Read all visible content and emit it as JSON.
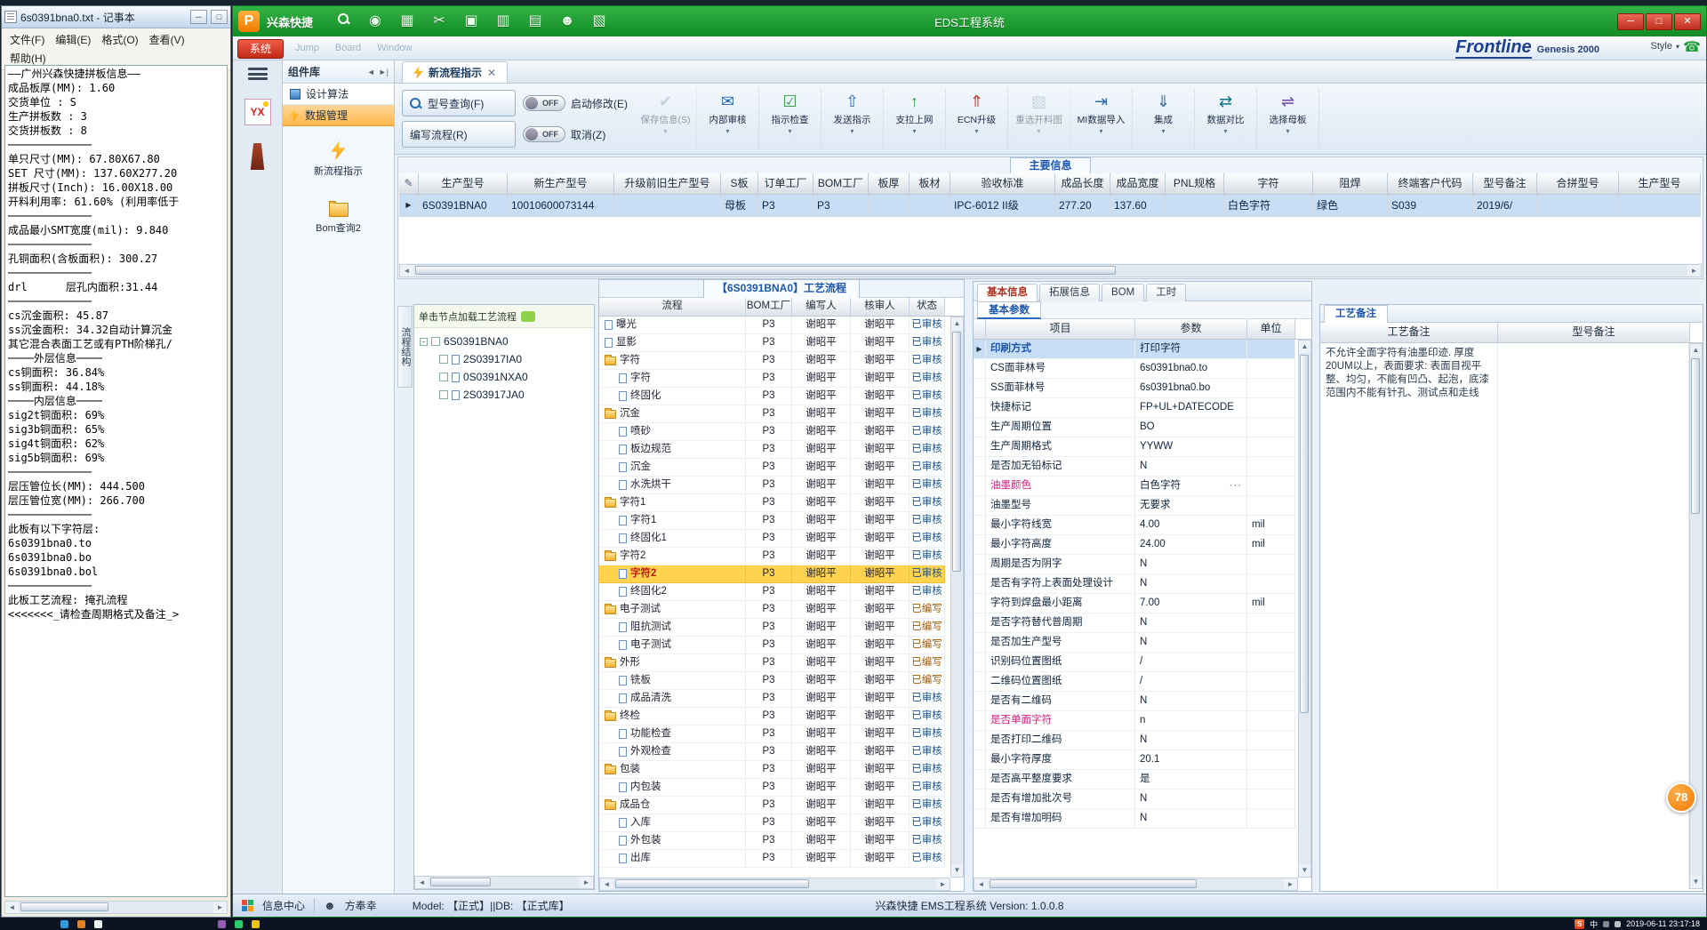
{
  "badge": {
    "value": "78"
  },
  "taskbar": {
    "datetime": "2019-06-11 23:17:18",
    "ime": "中"
  },
  "notepad": {
    "title": "6s0391bna0.txt - 记事本",
    "menu": [
      "文件(F)",
      "编辑(E)",
      "格式(O)",
      "查看(V)",
      "帮助(H)"
    ],
    "lines": [
      "——广州兴森快捷拼板信息——",
      "成品板厚(MM): 1.60",
      "交货单位 : S",
      "生产拼板数 : 3",
      "交货拼板数 : 8",
      "─────────────",
      "",
      "单只尺寸(MM): 67.80X67.80",
      "SET 尺寸(MM): 137.60X277.20",
      "拼板尺寸(Inch): 16.00X18.00",
      "开料利用率: 61.60% (利用率低于",
      "─────────────",
      "",
      "成品最小SMT宽度(mil): 9.840",
      "─────────────",
      "",
      "孔铜面积(含板面积): 300.27",
      "─────────────",
      "",
      "drl      层孔内面积:31.44",
      "─────────────",
      "",
      "cs沉金面积: 45.87",
      "ss沉金面积: 34.32自动计算沉金",
      "其它混合表面工艺或有PTH阶梯孔/",
      "────外层信息────",
      "cs铜面积: 36.84%",
      "ss铜面积: 44.18%",
      "────内层信息────",
      "sig2t铜面积: 69%",
      "sig3b铜面积: 65%",
      "sig4t铜面积: 62%",
      "sig5b铜面积: 69%",
      "─────────────",
      "",
      "层压管位长(MM): 444.500",
      "层压管位宽(MM): 266.700",
      "─────────────",
      "",
      "此板有以下字符层:",
      "6s0391bna0.to",
      "6s0391bna0.bo",
      "6s0391bna0.bol",
      "─────────────",
      "",
      "此板工艺流程: 掩孔流程",
      "<<<<<<<_请检查周期格式及备注_>"
    ]
  },
  "app": {
    "titlebar": {
      "brand": "兴森快捷",
      "title": "EDS工程系统",
      "icons": [
        {
          "name": "search-icon",
          "glyph": ""
        },
        {
          "name": "globe-icon",
          "glyph": "◉"
        },
        {
          "name": "table-icon",
          "glyph": "▦"
        },
        {
          "name": "scissors-icon",
          "glyph": "✂"
        },
        {
          "name": "panel-icon",
          "glyph": "▣"
        },
        {
          "name": "columns-icon",
          "glyph": "▥"
        },
        {
          "name": "rows-icon",
          "glyph": "▤"
        },
        {
          "name": "user-icon",
          "glyph": "☻"
        },
        {
          "name": "layers-icon",
          "glyph": "▧"
        }
      ]
    },
    "menubar": {
      "items": [
        "Jump",
        "Board",
        "Window"
      ],
      "logo": "Frontline",
      "logo2": "Genesis 2000",
      "style_label": "Style"
    },
    "nav": {
      "system_tab": "系统",
      "panel_title": "组件库",
      "tab_design": "设计算法",
      "tab_data": "数据管理",
      "item_flow": "新流程指示",
      "item_bom": "Bom查询2"
    },
    "doc_tab": {
      "label": "新流程指示"
    },
    "ribbon": {
      "query": "型号查询(F)",
      "write": "编写流程(R)",
      "edit": "启动修改(E)",
      "cancel": "取消(Z)",
      "toggle_label": "OFF",
      "buttons": [
        {
          "name": "save-info-button",
          "label": "保存信息(S)",
          "icon": "save-icon",
          "glyph": "✔",
          "color": "#9aa8b5",
          "disabled": true
        },
        {
          "name": "internal-review-button",
          "label": "内部审核",
          "icon": "mail-icon",
          "glyph": "✉",
          "color": "#2b6cb0",
          "disabled": false
        },
        {
          "name": "instruction-check-button",
          "label": "指示检查",
          "icon": "check-icon",
          "glyph": "☑",
          "color": "#2f9e44",
          "disabled": false
        },
        {
          "name": "send-instruction-button",
          "label": "发送指示",
          "icon": "send-icon",
          "glyph": "⇧",
          "color": "#2b6cb0",
          "disabled": false
        },
        {
          "name": "upload-online-button",
          "label": "支拉上网",
          "icon": "upload-icon",
          "glyph": "↑",
          "color": "#2f9e44",
          "disabled": false
        },
        {
          "name": "ecn-upgrade-button",
          "label": "ECN升级",
          "icon": "ecn-icon",
          "glyph": "⇑",
          "color": "#c0392b",
          "disabled": false
        },
        {
          "name": "reselect-panel-button",
          "label": "重选开料图",
          "icon": "image-icon",
          "glyph": "▧",
          "color": "#98a8b8",
          "disabled": true
        },
        {
          "name": "mi-import-button",
          "label": "MI数据导入",
          "icon": "import-icon",
          "glyph": "⇥",
          "color": "#2b6cb0",
          "disabled": false
        },
        {
          "name": "integrate-button",
          "label": "集成",
          "icon": "integrate-icon",
          "glyph": "⇓",
          "color": "#2b6cb0",
          "disabled": false
        },
        {
          "name": "data-compare-button",
          "label": "数据对比",
          "icon": "compare-icon",
          "glyph": "⇄",
          "color": "#0b7285",
          "disabled": false
        },
        {
          "name": "select-motherboard-button",
          "label": "选择母板",
          "icon": "select-icon",
          "glyph": "⇌",
          "color": "#7048a8",
          "disabled": false
        }
      ]
    },
    "main_info": {
      "caption": "主要信息",
      "columns": [
        "生产型号",
        "新生产型号",
        "升级前旧生产型号",
        "S板",
        "订单工厂",
        "BOM工厂",
        "板厚",
        "板材",
        "验收标准",
        "成品长度",
        "成品宽度",
        "PNL规格",
        "字符",
        "阻焊",
        "终端客户代码",
        "型号备注",
        "合拼型号",
        "生产型号"
      ],
      "row": [
        "6S0391BNA0",
        "10010600073144",
        "",
        "母板",
        "P3",
        "P3",
        "",
        "",
        "IPC-6012 II级",
        "277.20",
        "137.60",
        "",
        "白色字符",
        "绿色",
        "S039",
        "2019/6/",
        "",
        ""
      ]
    },
    "tree": {
      "tab": "流程结构",
      "header": "单击节点加载工艺流程",
      "root": "6S0391BNA0",
      "children": [
        "2S03917IA0",
        "0S0391NXA0",
        "2S03917JA0"
      ]
    },
    "flow": {
      "title": "【6S0391BNA0】工艺流程",
      "columns": [
        "流程",
        "BOM工厂",
        "编写人",
        "核审人",
        "状态"
      ],
      "rows": [
        {
          "name": "曝光",
          "level": 1,
          "kind": "leaf",
          "bom": "P3",
          "writer": "谢昭平",
          "reviewer": "谢昭平",
          "status": "已审核",
          "highlight": false
        },
        {
          "name": "显影",
          "level": 1,
          "kind": "leaf",
          "bom": "P3",
          "writer": "谢昭平",
          "reviewer": "谢昭平",
          "status": "已审核",
          "highlight": false
        },
        {
          "name": "字符",
          "level": 1,
          "kind": "folder",
          "bom": "P3",
          "writer": "谢昭平",
          "reviewer": "谢昭平",
          "status": "已审核",
          "highlight": false
        },
        {
          "name": "字符",
          "level": 2,
          "kind": "leaf",
          "bom": "P3",
          "writer": "谢昭平",
          "reviewer": "谢昭平",
          "status": "已审核",
          "highlight": false
        },
        {
          "name": "终固化",
          "level": 2,
          "kind": "leaf",
          "bom": "P3",
          "writer": "谢昭平",
          "reviewer": "谢昭平",
          "status": "已审核",
          "highlight": false
        },
        {
          "name": "沉金",
          "level": 1,
          "kind": "folder",
          "bom": "P3",
          "writer": "谢昭平",
          "reviewer": "谢昭平",
          "status": "已审核",
          "highlight": false
        },
        {
          "name": "喷砂",
          "level": 2,
          "kind": "leaf",
          "bom": "P3",
          "writer": "谢昭平",
          "reviewer": "谢昭平",
          "status": "已审核",
          "highlight": false
        },
        {
          "name": "板边规范",
          "level": 2,
          "kind": "leaf",
          "bom": "P3",
          "writer": "谢昭平",
          "reviewer": "谢昭平",
          "status": "已审核",
          "highlight": false
        },
        {
          "name": "沉金",
          "level": 2,
          "kind": "leaf",
          "bom": "P3",
          "writer": "谢昭平",
          "reviewer": "谢昭平",
          "status": "已审核",
          "highlight": false
        },
        {
          "name": "水洗烘干",
          "level": 2,
          "kind": "leaf",
          "bom": "P3",
          "writer": "谢昭平",
          "reviewer": "谢昭平",
          "status": "已审核",
          "highlight": false
        },
        {
          "name": "字符1",
          "level": 1,
          "kind": "folder",
          "bom": "P3",
          "writer": "谢昭平",
          "reviewer": "谢昭平",
          "status": "已审核",
          "highlight": false
        },
        {
          "name": "字符1",
          "level": 2,
          "kind": "leaf",
          "bom": "P3",
          "writer": "谢昭平",
          "reviewer": "谢昭平",
          "status": "已审核",
          "highlight": false
        },
        {
          "name": "终固化1",
          "level": 2,
          "kind": "leaf",
          "bom": "P3",
          "writer": "谢昭平",
          "reviewer": "谢昭平",
          "status": "已审核",
          "highlight": false
        },
        {
          "name": "字符2",
          "level": 1,
          "kind": "folder",
          "bom": "P3",
          "writer": "谢昭平",
          "reviewer": "谢昭平",
          "status": "已审核",
          "highlight": false
        },
        {
          "name": "字符2",
          "level": 2,
          "kind": "leaf",
          "bom": "P3",
          "writer": "谢昭平",
          "reviewer": "谢昭平",
          "status": "已审核",
          "highlight": true
        },
        {
          "name": "终固化2",
          "level": 2,
          "kind": "leaf",
          "bom": "P3",
          "writer": "谢昭平",
          "reviewer": "谢昭平",
          "status": "已审核",
          "highlight": false
        },
        {
          "name": "电子测试",
          "level": 1,
          "kind": "folder",
          "bom": "P3",
          "writer": "谢昭平",
          "reviewer": "谢昭平",
          "status": "已编写",
          "highlight": false
        },
        {
          "name": "阻抗测试",
          "level": 2,
          "kind": "leaf",
          "bom": "P3",
          "writer": "谢昭平",
          "reviewer": "谢昭平",
          "status": "已编写",
          "highlight": false
        },
        {
          "name": "电子测试",
          "level": 2,
          "kind": "leaf",
          "bom": "P3",
          "writer": "谢昭平",
          "reviewer": "谢昭平",
          "status": "已编写",
          "highlight": false
        },
        {
          "name": "外形",
          "level": 1,
          "kind": "folder",
          "bom": "P3",
          "writer": "谢昭平",
          "reviewer": "谢昭平",
          "status": "已编写",
          "highlight": false
        },
        {
          "name": "铣板",
          "level": 2,
          "kind": "leaf",
          "bom": "P3",
          "writer": "谢昭平",
          "reviewer": "谢昭平",
          "status": "已编写",
          "highlight": false
        },
        {
          "name": "成品清洗",
          "level": 2,
          "kind": "leaf",
          "bom": "P3",
          "writer": "谢昭平",
          "reviewer": "谢昭平",
          "status": "已审核",
          "highlight": false
        },
        {
          "name": "终检",
          "level": 1,
          "kind": "folder",
          "bom": "P3",
          "writer": "谢昭平",
          "reviewer": "谢昭平",
          "status": "已审核",
          "highlight": false
        },
        {
          "name": "功能检查",
          "level": 2,
          "kind": "leaf",
          "bom": "P3",
          "writer": "谢昭平",
          "reviewer": "谢昭平",
          "status": "已审核",
          "highlight": false
        },
        {
          "name": "外观检查",
          "level": 2,
          "kind": "leaf",
          "bom": "P3",
          "writer": "谢昭平",
          "reviewer": "谢昭平",
          "status": "已审核",
          "highlight": false
        },
        {
          "name": "包装",
          "level": 1,
          "kind": "folder",
          "bom": "P3",
          "writer": "谢昭平",
          "reviewer": "谢昭平",
          "status": "已审核",
          "highlight": false
        },
        {
          "name": "内包装",
          "level": 2,
          "kind": "leaf",
          "bom": "P3",
          "writer": "谢昭平",
          "reviewer": "谢昭平",
          "status": "已审核",
          "highlight": false
        },
        {
          "name": "成品仓",
          "level": 1,
          "kind": "folder",
          "bom": "P3",
          "writer": "谢昭平",
          "reviewer": "谢昭平",
          "status": "已审核",
          "highlight": false
        },
        {
          "name": "入库",
          "level": 2,
          "kind": "leaf",
          "bom": "P3",
          "writer": "谢昭平",
          "reviewer": "谢昭平",
          "status": "已审核",
          "highlight": false
        },
        {
          "name": "外包装",
          "level": 2,
          "kind": "leaf",
          "bom": "P3",
          "writer": "谢昭平",
          "reviewer": "谢昭平",
          "status": "已审核",
          "highlight": false
        },
        {
          "name": "出库",
          "level": 2,
          "kind": "leaf",
          "bom": "P3",
          "writer": "谢昭平",
          "reviewer": "谢昭平",
          "status": "已审核",
          "highlight": false
        }
      ]
    },
    "params": {
      "tabs": [
        "基本信息",
        "拓展信息",
        "BOM",
        "工时"
      ],
      "subtab": "基本参数",
      "columns": [
        "项目",
        "参数",
        "单位"
      ],
      "rows": [
        {
          "item": "印刷方式",
          "value": "打印字符",
          "unit": "",
          "selected": true,
          "pink": false,
          "more": false
        },
        {
          "item": "CS面菲林号",
          "value": "6s0391bna0.to",
          "unit": "",
          "selected": false,
          "pink": false,
          "more": false
        },
        {
          "item": "SS面菲林号",
          "value": "6s0391bna0.bo",
          "unit": "",
          "selected": false,
          "pink": false,
          "more": false
        },
        {
          "item": "快捷标记",
          "value": "FP+UL+DATECODE",
          "unit": "",
          "selected": false,
          "pink": false,
          "more": false
        },
        {
          "item": "生产周期位置",
          "value": "BO",
          "unit": "",
          "selected": false,
          "pink": false,
          "more": false
        },
        {
          "item": "生产周期格式",
          "value": "YYWW",
          "unit": "",
          "selected": false,
          "pink": false,
          "more": false
        },
        {
          "item": "是否加无铅标记",
          "value": "N",
          "unit": "",
          "selected": false,
          "pink": false,
          "more": false
        },
        {
          "item": "油墨颜色",
          "value": "白色字符",
          "unit": "",
          "selected": false,
          "pink": true,
          "more": true
        },
        {
          "item": "油墨型号",
          "value": "无要求",
          "unit": "",
          "selected": false,
          "pink": false,
          "more": false
        },
        {
          "item": "最小字符线宽",
          "value": "4.00",
          "unit": "mil",
          "selected": false,
          "pink": false,
          "more": false
        },
        {
          "item": "最小字符高度",
          "value": "24.00",
          "unit": "mil",
          "selected": false,
          "pink": false,
          "more": false
        },
        {
          "item": "周期是否为阴字",
          "value": "N",
          "unit": "",
          "selected": false,
          "pink": false,
          "more": false
        },
        {
          "item": "是否有字符上表面处理设计",
          "value": "N",
          "unit": "",
          "selected": false,
          "pink": false,
          "more": false
        },
        {
          "item": "字符到焊盘最小距离",
          "value": "7.00",
          "unit": "mil",
          "selected": false,
          "pink": false,
          "more": false
        },
        {
          "item": "是否字符替代普周期",
          "value": "N",
          "unit": "",
          "selected": false,
          "pink": false,
          "more": false
        },
        {
          "item": "是否加生产型号",
          "value": "N",
          "unit": "",
          "selected": false,
          "pink": false,
          "more": false
        },
        {
          "item": "识别码位置图纸",
          "value": "/",
          "unit": "",
          "selected": false,
          "pink": false,
          "more": false
        },
        {
          "item": "二维码位置图纸",
          "value": "/",
          "unit": "",
          "selected": false,
          "pink": false,
          "more": false
        },
        {
          "item": "是否有二维码",
          "value": "N",
          "unit": "",
          "selected": false,
          "pink": false,
          "more": false
        },
        {
          "item": "是否单面字符",
          "value": "n",
          "unit": "",
          "selected": false,
          "pink": true,
          "more": false
        },
        {
          "item": "是否打印二维码",
          "value": "N",
          "unit": "",
          "selected": false,
          "pink": false,
          "more": false
        },
        {
          "item": "最小字符厚度",
          "value": "20.1",
          "unit": "",
          "selected": false,
          "pink": false,
          "more": false
        },
        {
          "item": "是否高平整度要求",
          "value": "是",
          "unit": "",
          "selected": false,
          "pink": false,
          "more": false
        },
        {
          "item": "是否有增加批次号",
          "value": "N",
          "unit": "",
          "selected": false,
          "pink": false,
          "more": false
        },
        {
          "item": "是否有增加明码",
          "value": "N",
          "unit": "",
          "selected": false,
          "pink": false,
          "more": false
        }
      ]
    },
    "remarks": {
      "tab": "工艺备注",
      "columns": [
        "工艺备注",
        "型号备注"
      ],
      "text": "不允许全面字符有油墨印迹. 厚度20UM以上，表面要求: 表面目视平整、均匀，不能有凹凸、起泡，底漆范围内不能有针孔、测试点和走线"
    },
    "statusbar": {
      "info_center": "信息中心",
      "user": "方奉幸",
      "model": "Model: 【正式】||DB: 【正式库】",
      "version": "兴森快捷 EMS工程系统 Version: 1.0.0.8"
    }
  }
}
